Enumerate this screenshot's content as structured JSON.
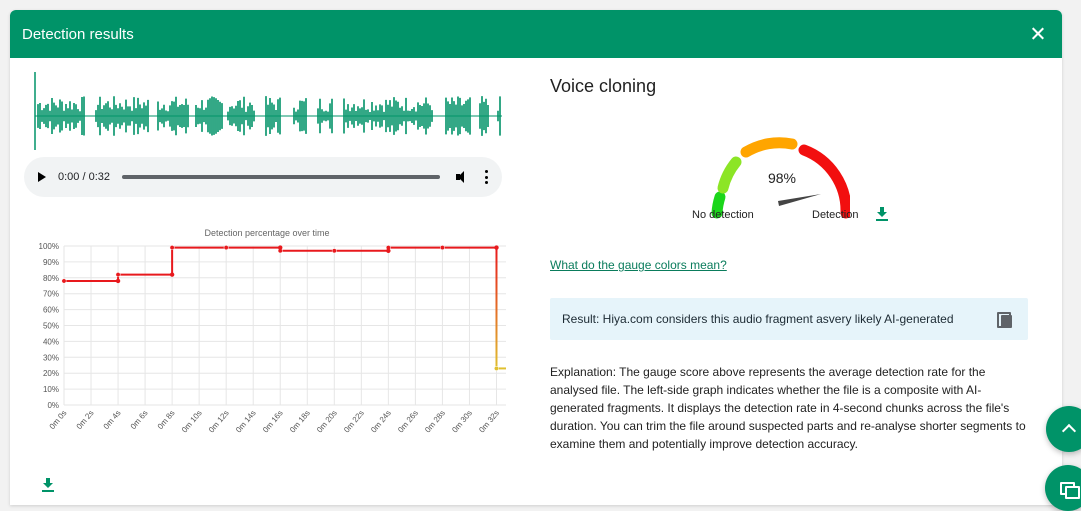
{
  "modal": {
    "title": "Detection results"
  },
  "player": {
    "time": "0:00 / 0:32"
  },
  "chart_data": {
    "type": "line",
    "title": "Detection percentage over time",
    "xlabel": "",
    "ylabel": "",
    "x_ticks": [
      "0m 0s",
      "0m 2s",
      "0m 4s",
      "0m 6s",
      "0m 8s",
      "0m 10s",
      "0m 12s",
      "0m 14s",
      "0m 16s",
      "0m 18s",
      "0m 20s",
      "0m 22s",
      "0m 24s",
      "0m 26s",
      "0m 28s",
      "0m 30s",
      "0m 32s"
    ],
    "y_ticks": [
      "0%",
      "10%",
      "20%",
      "30%",
      "40%",
      "50%",
      "60%",
      "70%",
      "80%",
      "90%",
      "100%"
    ],
    "ylim": [
      0,
      100
    ],
    "xlim": [
      0,
      33
    ],
    "grid": true,
    "step": true,
    "x": [
      0,
      4,
      8,
      12,
      16,
      20,
      24,
      28,
      32,
      33
    ],
    "values": [
      78,
      82,
      99,
      99,
      97,
      97,
      99,
      99,
      23,
      23
    ],
    "colors": {
      "line": "#e8191d",
      "tail": "#e0c030"
    }
  },
  "right": {
    "title": "Voice cloning",
    "gauge": {
      "value_text": "98%",
      "value": 98,
      "label_low": "No detection",
      "label_high": "Detection"
    },
    "link": "What do the gauge colors mean?",
    "result": "Result: Hiya.com considers this audio fragment asvery likely AI-generated",
    "explanation": "Explanation: The gauge score above represents the average detection rate for the analysed file. The left-side graph indicates whether the file is a composite with AI-generated fragments. It displays the detection rate in 4-second chunks across the file's duration. You can trim the file around suspected parts and re-analyse shorter segments to examine them and potentially improve detection accuracy."
  },
  "colors": {
    "brand": "#009368",
    "result_bg": "#e6f4fa"
  },
  "icons": [
    "close-icon",
    "play-icon",
    "volume-icon",
    "more-icon",
    "download-icon",
    "copy-icon",
    "chevron-up-icon",
    "chat-icon"
  ]
}
